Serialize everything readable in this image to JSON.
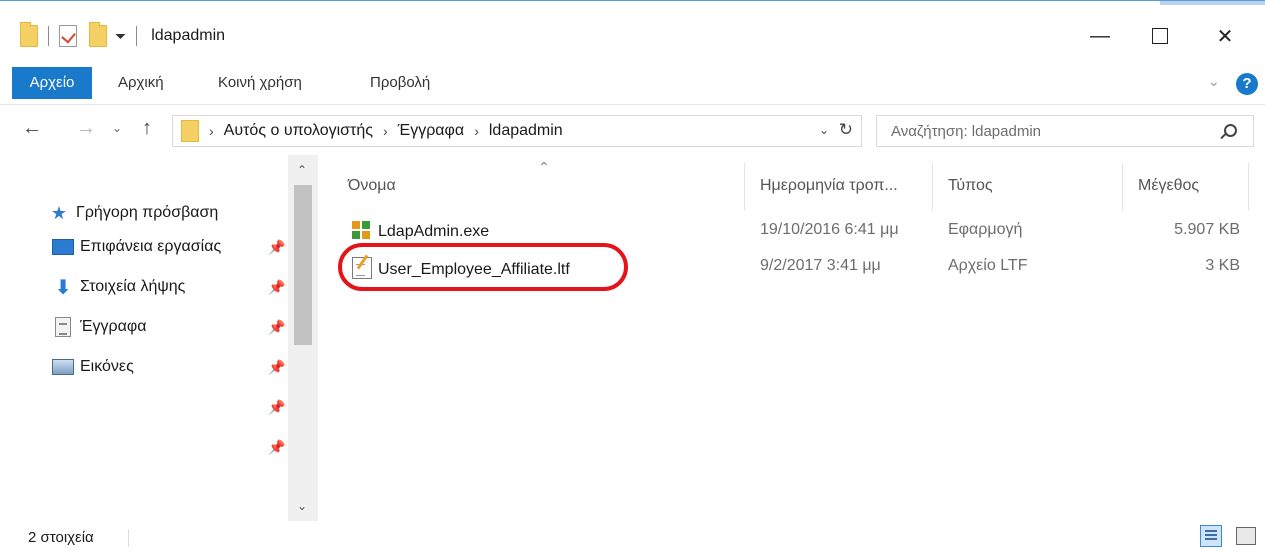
{
  "window": {
    "title": "ldapadmin"
  },
  "ribbon": {
    "tabs": [
      "Αρχείο",
      "Αρχική",
      "Κοινή χρήση",
      "Προβολή"
    ]
  },
  "address": {
    "breadcrumbs": [
      "Αυτός ο υπολογιστής",
      "Έγγραφα",
      "ldapadmin"
    ],
    "search_placeholder": "Αναζήτηση: ldapadmin"
  },
  "navpane": {
    "quick_access": "Γρήγορη πρόσβαση",
    "items": [
      {
        "label": "Επιφάνεια εργασίας",
        "icon": "desktop-icon"
      },
      {
        "label": "Στοιχεία λήψης",
        "icon": "download-icon"
      },
      {
        "label": "Έγγραφα",
        "icon": "document-icon"
      },
      {
        "label": "Εικόνες",
        "icon": "pictures-icon"
      }
    ]
  },
  "files": {
    "columns": [
      "Όνομα",
      "Ημερομηνία τροπ...",
      "Τύπος",
      "Μέγεθος"
    ],
    "rows": [
      {
        "name": "LdapAdmin.exe",
        "date": "19/10/2016 6:41 μμ",
        "type": "Εφαρμογή",
        "size": "5.907 KB",
        "icon": "application-icon"
      },
      {
        "name": "User_Employee_Affiliate.ltf",
        "date": "9/2/2017 3:41 μμ",
        "type": "Αρχείο LTF",
        "size": "3 KB",
        "icon": "ltf-file-icon"
      }
    ]
  },
  "status": {
    "count": "2 στοιχεία"
  },
  "colors": {
    "accent": "#1979ca",
    "highlight": "#e4141b"
  }
}
